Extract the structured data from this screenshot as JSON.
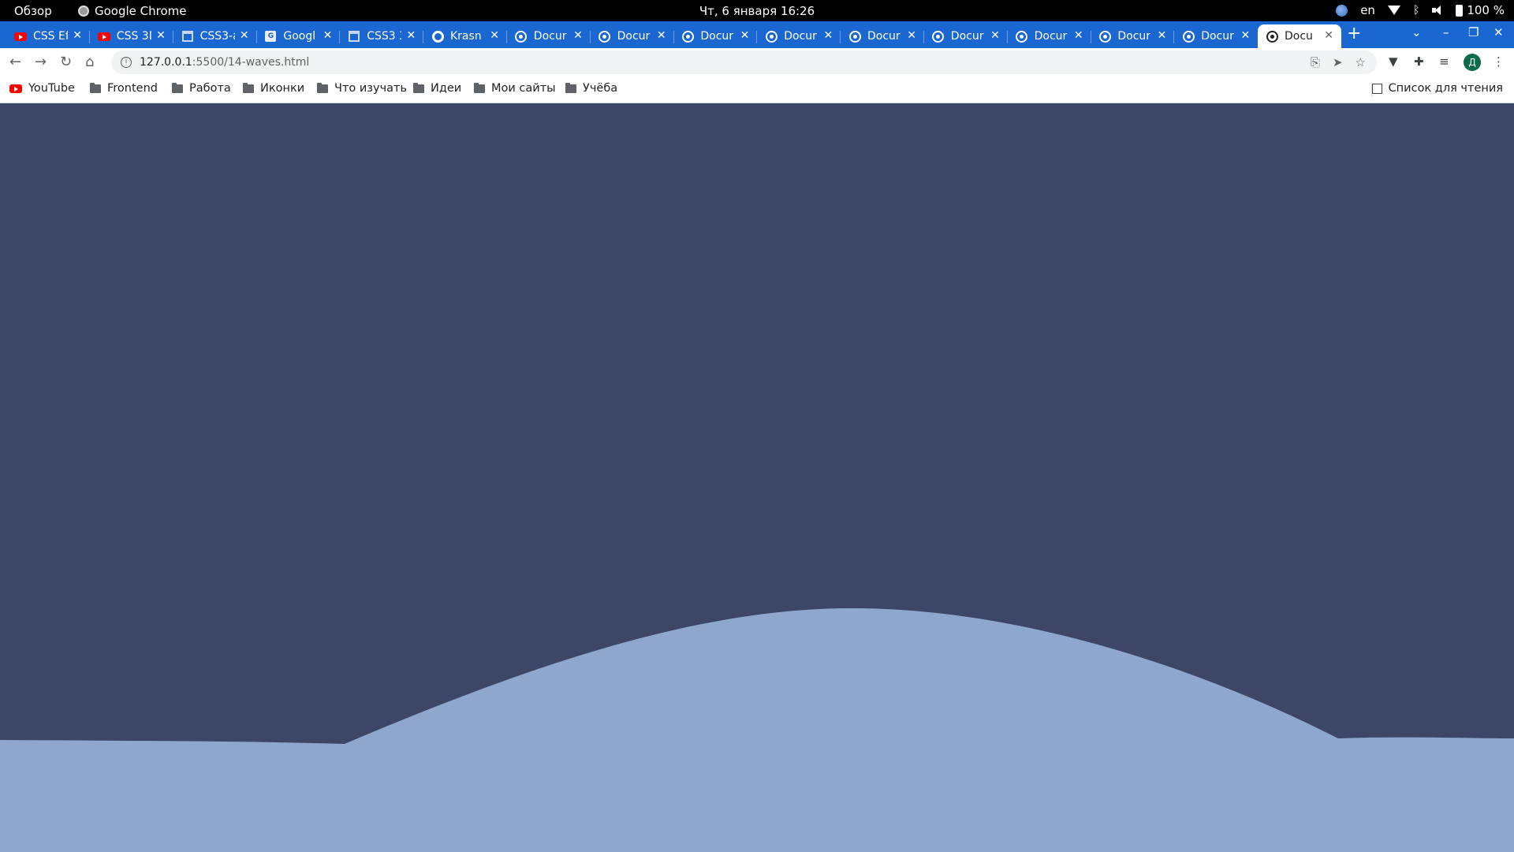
{
  "os_bar": {
    "activities": "Обзор",
    "app_name": "Google Chrome",
    "clock": "Чт, 6 января  16:26",
    "lang": "en",
    "battery": "100 %"
  },
  "tabs": [
    {
      "title": "CSS Ef",
      "favicon": "youtube-icon"
    },
    {
      "title": "CSS 3D",
      "favicon": "youtube-icon"
    },
    {
      "title": "CSS3-a",
      "favicon": "htmlacademy-icon"
    },
    {
      "title": "Googl",
      "favicon": "google-translate-icon"
    },
    {
      "title": "CSS3 3",
      "favicon": "htmlacademy-icon"
    },
    {
      "title": "Krasn",
      "favicon": "github-icon"
    },
    {
      "title": "Docur",
      "favicon": "globe-icon"
    },
    {
      "title": "Docur",
      "favicon": "globe-icon"
    },
    {
      "title": "Docur",
      "favicon": "globe-icon"
    },
    {
      "title": "Docur",
      "favicon": "globe-icon"
    },
    {
      "title": "Docur",
      "favicon": "globe-icon"
    },
    {
      "title": "Docur",
      "favicon": "globe-icon"
    },
    {
      "title": "Docur",
      "favicon": "globe-icon"
    },
    {
      "title": "Docur",
      "favicon": "globe-icon"
    },
    {
      "title": "Docur",
      "favicon": "globe-icon"
    },
    {
      "title": "Docu",
      "favicon": "globe-icon",
      "active": true
    }
  ],
  "tab_close_glyph": "✕",
  "new_tab_glyph": "+",
  "omnibox": {
    "host": "127.0.0.1",
    "path": ":5500/14-waves.html"
  },
  "avatar_letter": "Д",
  "bookmarks": [
    {
      "label": "YouTube",
      "icon": "youtube-icon"
    },
    {
      "label": "Frontend",
      "icon": "folder-icon"
    },
    {
      "label": "Работа",
      "icon": "folder-icon"
    },
    {
      "label": "Иконки",
      "icon": "folder-icon"
    },
    {
      "label": "Что изучать",
      "icon": "folder-icon"
    },
    {
      "label": "Идеи",
      "icon": "folder-icon"
    },
    {
      "label": "Мои сайты",
      "icon": "folder-icon"
    },
    {
      "label": "Учёба",
      "icon": "folder-icon"
    }
  ],
  "reading_list": "Список для чтения",
  "colors": {
    "page_background": "#3d4667",
    "wave_fill": "#8fa7cd",
    "tabstrip": "#1a67d2"
  }
}
